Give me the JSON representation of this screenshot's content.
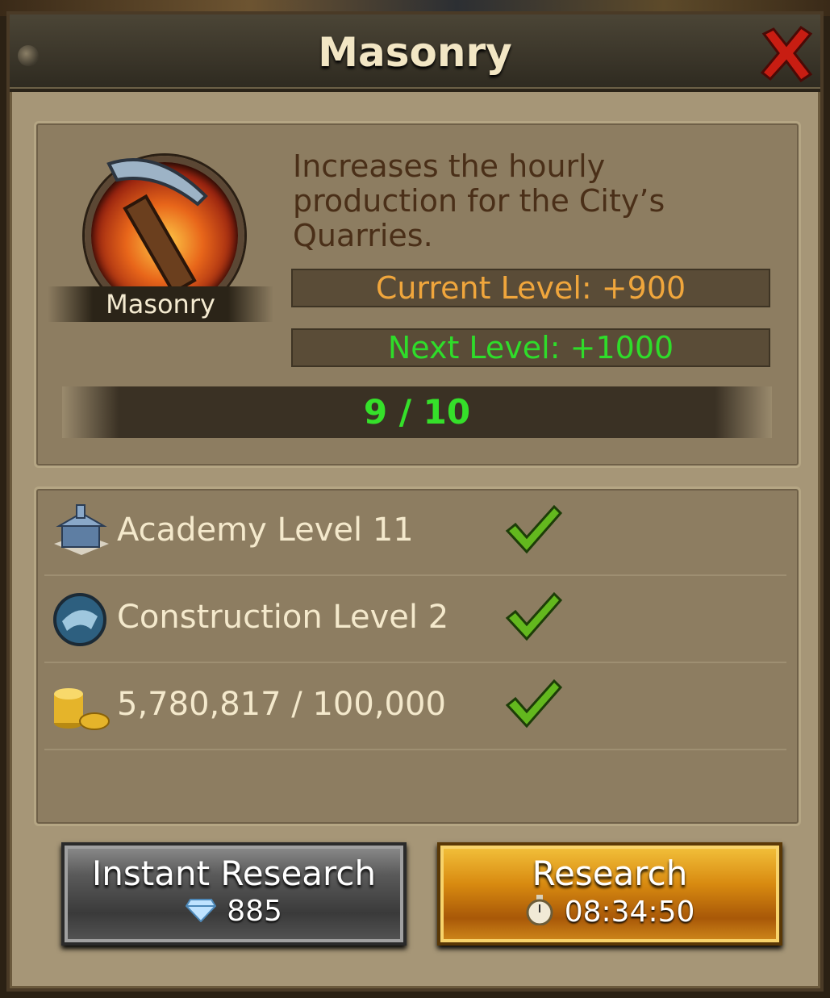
{
  "window": {
    "title": "Masonry",
    "close_icon": "close-x-icon"
  },
  "research": {
    "icon": "pickaxe-fire-icon",
    "name": "Masonry",
    "description": "Increases the hourly production for the City’s Quarries.",
    "current_level": "Current Level: +900",
    "next_level": "Next Level: +1000",
    "progress_text": "9 / 10",
    "progress_value": 9,
    "progress_max": 10
  },
  "requirements": [
    {
      "icon": "academy-building-icon",
      "label": "Academy Level 11",
      "met": true,
      "status_icon": "checkmark-icon"
    },
    {
      "icon": "construction-research-icon",
      "label": "Construction Level 2",
      "met": true,
      "status_icon": "checkmark-icon"
    },
    {
      "icon": "gold-coins-icon",
      "label": "5,780,817 / 100,000",
      "met": true,
      "status_icon": "checkmark-icon"
    }
  ],
  "actions": {
    "instant": {
      "label": "Instant Research",
      "cost": "885",
      "icon": "gem-icon"
    },
    "research": {
      "label": "Research",
      "time": "08:34:50",
      "icon": "stopwatch-icon"
    }
  },
  "colors": {
    "current_level": "#f0a63c",
    "next_level": "#2fdc2a",
    "progress_text": "#35e02a",
    "description": "#4a2f18"
  }
}
